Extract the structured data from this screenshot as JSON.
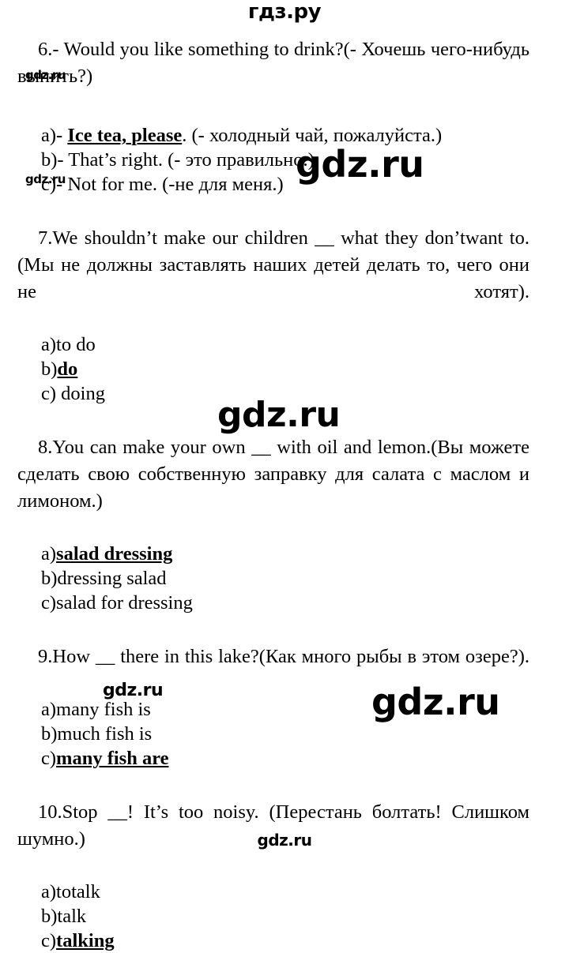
{
  "watermarks": {
    "header": "гдз.ру",
    "footer": "gdz.ru",
    "brand": "gdz.ru",
    "marks": [
      {
        "id": "wm-a",
        "text": "gdz.ru",
        "size": "small"
      },
      {
        "id": "wm-b",
        "text": "gdz.ru",
        "size": "small"
      },
      {
        "id": "wm-c",
        "text": "gdz.ru",
        "size": "big"
      },
      {
        "id": "wm-d",
        "text": "gdz.ru",
        "size": "mid"
      },
      {
        "id": "wm-e",
        "text": "gdz.ru",
        "size": "small-bold"
      },
      {
        "id": "wm-f",
        "text": "gdz.ru",
        "size": "big"
      }
    ]
  },
  "questions": [
    {
      "number": "6.",
      "stem": "6.- Would you like something to drink?(- Хочешь чего-нибудь выпить?)",
      "options": [
        {
          "letter": "a)-",
          "before": " ",
          "answer": "Ice tea, please",
          "after": ". (- холодный чай, пожалуйста.)",
          "correct": true
        },
        {
          "letter": "b)-",
          "before": " ",
          "answer": "",
          "after": "That’s right. (- это правильно.)",
          "correct": false
        },
        {
          "letter": "c)-",
          "before": " ",
          "answer": "",
          "after": "Not for me. (-не для меня.)",
          "correct": false
        }
      ]
    },
    {
      "number": "7.",
      "stem": "7.We shouldn’t make our children __ what they don’twant to.(Мы не должны заставлять наших детей делать то, чего они не хотят).",
      "options": [
        {
          "letter": "a)",
          "before": "",
          "answer": "",
          "after": "to do",
          "correct": false
        },
        {
          "letter": "b)",
          "before": "",
          "answer": "do",
          "after": "",
          "correct": true
        },
        {
          "letter": "c)",
          "before": "",
          "answer": "",
          "after": " doing",
          "correct": false
        }
      ]
    },
    {
      "number": "8.",
      "stem": "8.You can make your own __ with oil and lemon.(Вы можете сделать свою собственную заправку для салата с маслом и лимоном.)",
      "options": [
        {
          "letter": "a)",
          "before": "",
          "answer": "salad dressing",
          "after": "",
          "correct": true
        },
        {
          "letter": "b)",
          "before": "",
          "answer": "",
          "after": "dressing salad",
          "correct": false
        },
        {
          "letter": "c)",
          "before": "",
          "answer": "",
          "after": "salad for dressing",
          "correct": false
        }
      ]
    },
    {
      "number": "9.",
      "stem": "9.How __ there in this lake?(Как много рыбы в этом озере?).",
      "options": [
        {
          "letter": "a)",
          "before": "",
          "answer": "",
          "after": "many fish is",
          "correct": false
        },
        {
          "letter": "b)",
          "before": "",
          "answer": "",
          "after": "much fish is",
          "correct": false
        },
        {
          "letter": "c)",
          "before": "",
          "answer": "many fish are",
          "after": "",
          "correct": true
        }
      ]
    },
    {
      "number": "10.",
      "stem": "10.Stop __! It’s too noisy. (Перестань болтать! Слишком шумно.)",
      "options": [
        {
          "letter": "a)",
          "before": "",
          "answer": "",
          "after": "totalk",
          "correct": false
        },
        {
          "letter": "b)",
          "before": "",
          "answer": "",
          "after": "talk",
          "correct": false
        },
        {
          "letter": "c)",
          "before": "",
          "answer": "talking",
          "after": "",
          "correct": true
        }
      ]
    }
  ]
}
